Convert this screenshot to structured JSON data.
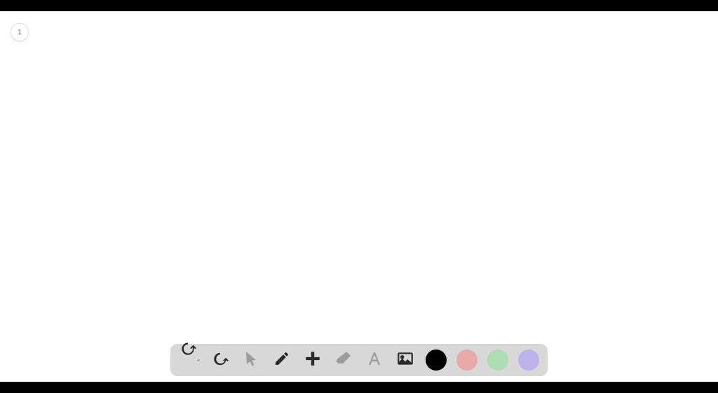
{
  "page": {
    "number": "1"
  },
  "toolbar": {
    "tools": [
      {
        "name": "undo",
        "active": true
      },
      {
        "name": "redo",
        "active": true
      },
      {
        "name": "select",
        "active": false
      },
      {
        "name": "pencil",
        "active": true
      },
      {
        "name": "add",
        "active": true
      },
      {
        "name": "eraser",
        "active": false
      },
      {
        "name": "text",
        "active": false
      },
      {
        "name": "image",
        "active": true
      }
    ],
    "colors": {
      "current": "#000000",
      "palette": [
        "#e8a9a9",
        "#aedcb3",
        "#bdb3ea"
      ]
    }
  }
}
